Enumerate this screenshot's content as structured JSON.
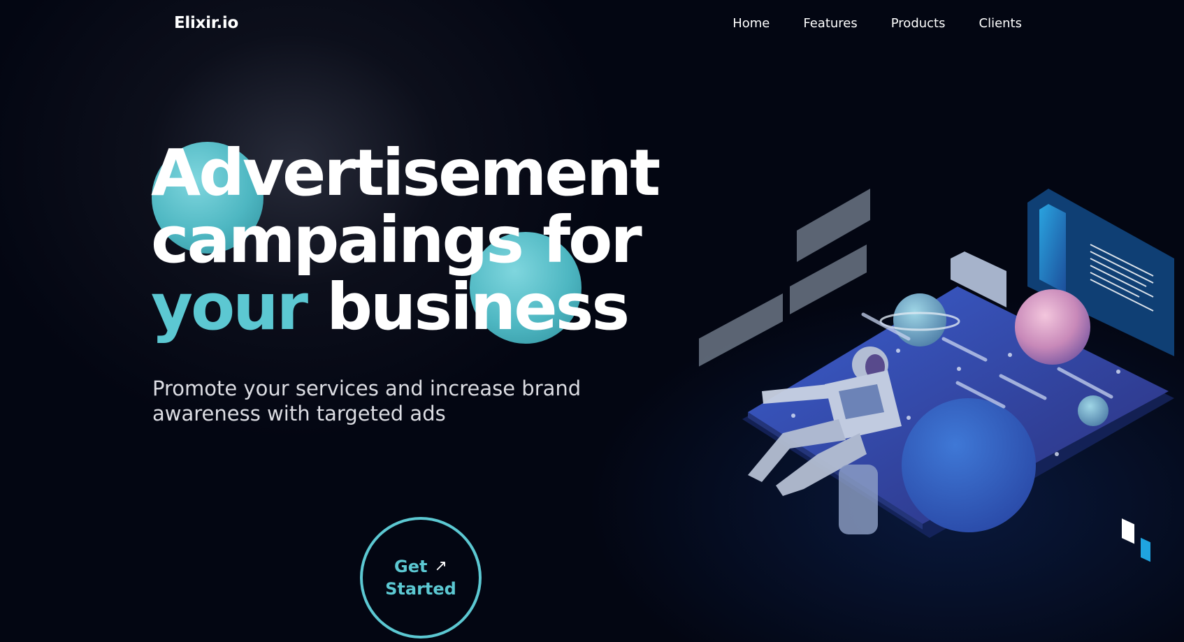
{
  "header": {
    "logo": "Elixir.io",
    "nav": [
      {
        "label": "Home"
      },
      {
        "label": "Features"
      },
      {
        "label": "Products"
      },
      {
        "label": "Clients"
      }
    ]
  },
  "hero": {
    "headline": {
      "line1": "Advertisement",
      "line2": "campaings for",
      "line3_accent": "your",
      "line3_rest": "business"
    },
    "subtitle_line1": "Promote your services and increase brand",
    "subtitle_line2": "awareness with targeted ads",
    "cta": {
      "line1": "Get",
      "line2": "Started",
      "icon": "arrow-up-right-icon"
    }
  },
  "illustration": {
    "icon": "astronaut-isometric-illustration"
  },
  "colors": {
    "background": "#030612",
    "accent": "#5cc8d2",
    "text": "#ffffff",
    "subtitle": "#dcdde3"
  }
}
